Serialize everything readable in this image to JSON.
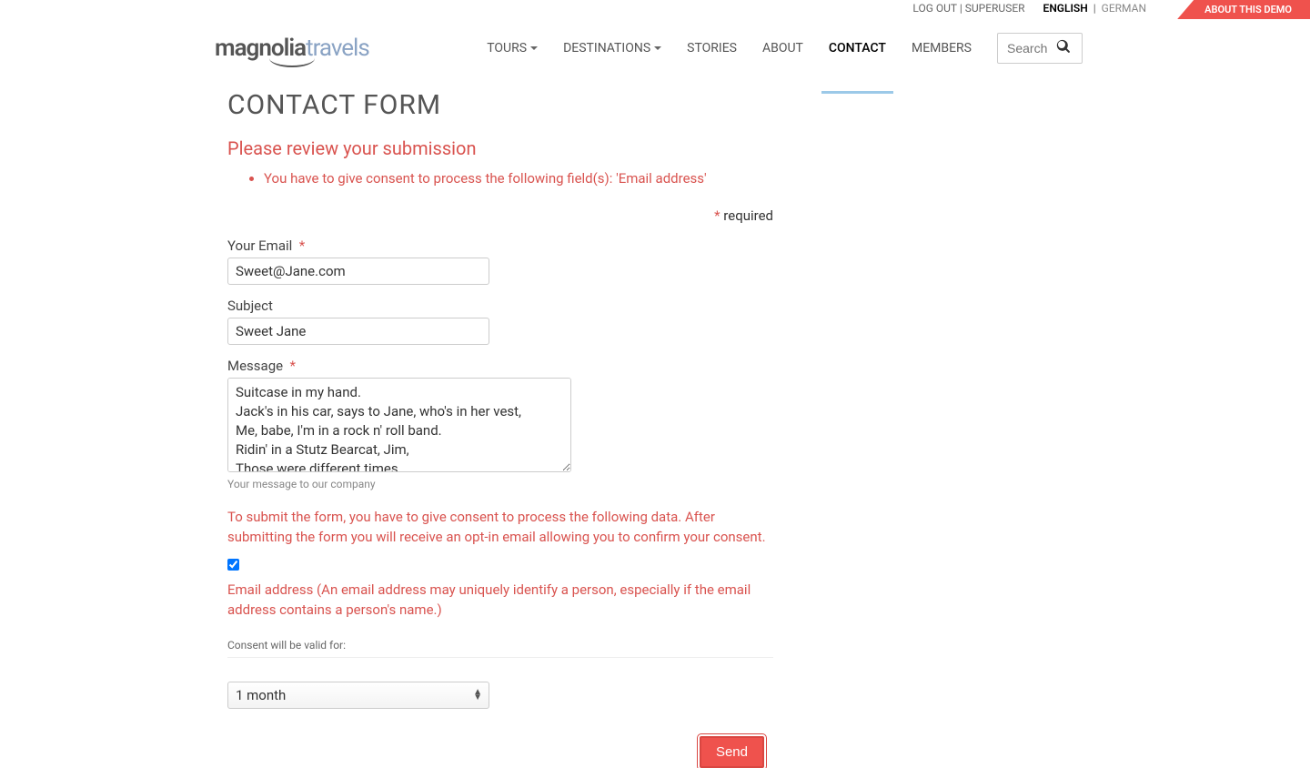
{
  "topbar": {
    "logout": "LOG OUT",
    "sep1": " | ",
    "user": "SUPERUSER",
    "lang_en": "ENGLISH",
    "lang_sep": " | ",
    "lang_de": "GERMAN",
    "demo_ribbon": "ABOUT THIS DEMO"
  },
  "logo": {
    "part1": "magnolia",
    "part2": "travels"
  },
  "nav": {
    "tours": "TOURS",
    "destinations": "DESTINATIONS",
    "stories": "STORIES",
    "about": "ABOUT",
    "contact": "CONTACT",
    "members": "MEMBERS",
    "search_placeholder": "Search"
  },
  "page": {
    "title": "CONTACT FORM",
    "error_heading": "Please review your submission",
    "error_items": [
      "You have to give consent to process the following field(s): 'Email address'"
    ],
    "required_star": "*",
    "required_text": " required"
  },
  "form": {
    "email": {
      "label": "Your Email",
      "required": true,
      "value": "Sweet@Jane.com"
    },
    "subject": {
      "label": "Subject",
      "required": false,
      "value": "Sweet Jane"
    },
    "message": {
      "label": "Message",
      "required": true,
      "value": "Suitcase in my hand.\nJack's in his car, says to Jane, who's in her vest,\nMe, babe, I'm in a rock n' roll band.\nRidin' in a Stutz Bearcat, Jim,\nThose were different times.",
      "hint": "Your message to our company"
    },
    "consent": {
      "intro": "To submit the form, you have to give consent to process the following data. After submitting the form you will receive an opt-in email allowing you to confirm your consent.",
      "checked": true,
      "label": "Email address (An email address may uniquely identify a person, especially if the email address contains a person's name.)"
    },
    "validity": {
      "label": "Consent will be valid for:",
      "selected": "1 month"
    },
    "send": "Send"
  }
}
